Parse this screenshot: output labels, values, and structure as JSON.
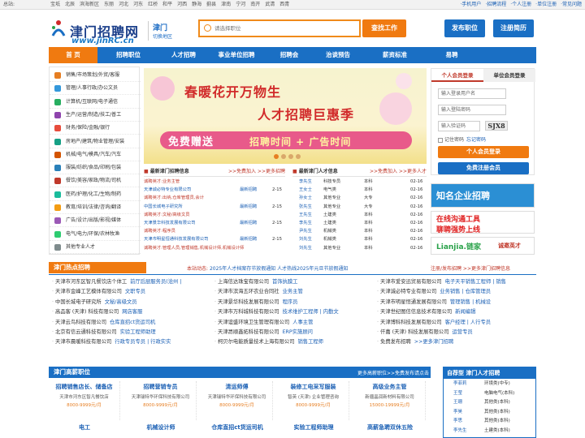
{
  "topbar": {
    "label": "总站:",
    "sites": [
      "宝坻",
      "北辰",
      "滨海新区",
      "东丽",
      "河北",
      "河东",
      "红桥",
      "和平",
      "河西",
      "静海",
      "蓟县",
      "津南",
      "宁河",
      "南开",
      "武清",
      "西青"
    ],
    "links": [
      "·手机用户",
      "·招聘流程",
      "·个人注册",
      "·单位注册",
      "·常见问题"
    ]
  },
  "header": {
    "logo_cn": "津门招聘网",
    "logo_en": "www.jinRC.cn",
    "city": "津门",
    "city_switch": "切换地区",
    "search_placeholder": "请选择职位",
    "search_btn": "查找工作",
    "post_job_btn": "发布职位",
    "register_resume_btn": "注册简历"
  },
  "nav": [
    "首 页",
    "招聘职位",
    "人才招聘",
    "事业单位招聘",
    "招聘会",
    "治谈预告",
    "薪资标准",
    "易聘"
  ],
  "sidebar": [
    "销售/市场策划/外贸/客服",
    "管理/人事行政/办公文员",
    "计算机/互联网/电子通信",
    "生产/运营/制造/技工/普工",
    "财务/保险/金融/银行",
    "房地产/建筑/物业管理/安装",
    "机械/电气/模具/汽车/汽车",
    "服装/纺织/食品/印刷/包装",
    "餐饮/美容/家政/物流/司机",
    "医药/护理/化工/生物/制药",
    "教育/培训/法律/咨询/翻译",
    "广告/设计/出版/影视/媒体",
    "电气/电力/环保/农林牧渔",
    "其他专业人才"
  ],
  "banner": {
    "line1": "春暖花开万物生",
    "line2": "人才招聘巨惠季",
    "line3": "免费赠送",
    "line4": "招聘时间 + 广告时间"
  },
  "login": {
    "tab_person": "个人会员登录",
    "tab_company": "单位会员登录",
    "user_placeholder": "输入登录用户名",
    "pwd_placeholder": "输入登陆密码",
    "code_placeholder": "输入验证码",
    "captcha": "SJX8",
    "remember": "记住密码",
    "forgot": "忘记密码",
    "login_btn": "个人会员登录",
    "register_btn": "免费注册会员"
  },
  "latest_jobs": {
    "title": "最新津门招聘信息",
    "more": ">>免费加入 >>更多招聘",
    "rows": [
      {
        "text": "诚聘英才:业务主管",
        "tag": "",
        "date": ""
      },
      {
        "text": "天津诚必特专业有限公司",
        "tag": "最新招聘",
        "date": "2-15"
      },
      {
        "text": "诚聘英才:出纳,仓库管理员,会计",
        "tag": "",
        "date": ""
      },
      {
        "text": "中国长城电子研究所",
        "tag": "最新招聘",
        "date": "2-15"
      },
      {
        "text": "诚聘英才:文秘/高级文员",
        "tag": "",
        "date": ""
      },
      {
        "text": "天津景华科技发展有限公司",
        "tag": "最新招聘",
        "date": "2-15"
      },
      {
        "text": "诚聘英才:程序员",
        "tag": "",
        "date": ""
      },
      {
        "text": "天津市明星恒通科技发展有限公司",
        "tag": "最新招聘",
        "date": "2-15"
      },
      {
        "text": "诚聘英才:管理人员,管理销售,机械设计师,机械设计师",
        "tag": "",
        "date": ""
      }
    ]
  },
  "latest_talent": {
    "title": "最新津门人才信息",
    "more": ">>免费加入 >>更多人才",
    "rows": [
      {
        "name": "李先生",
        "job": "科技专员",
        "edu": "本科",
        "date": "02-16"
      },
      {
        "name": "王女士",
        "job": "电气类",
        "edu": "本科",
        "date": "02-16"
      },
      {
        "name": "孙女士",
        "job": "其他专业",
        "edu": "大专",
        "date": "02-16"
      },
      {
        "name": "张先生",
        "job": "其他专业",
        "edu": "大专",
        "date": "02-16"
      },
      {
        "name": "王先生",
        "job": "土建类",
        "edu": "本科",
        "date": "02-16"
      },
      {
        "name": "李先生",
        "job": "土建类",
        "edu": "本科",
        "date": "02-16"
      },
      {
        "name": "尹先生",
        "job": "机械类",
        "edu": "本科",
        "date": "02-16"
      },
      {
        "name": "刘先生",
        "job": "机械类",
        "edu": "本科",
        "date": "02-16"
      },
      {
        "name": "刘先生",
        "job": "其他专业",
        "edu": "本科",
        "date": "02-16"
      }
    ]
  },
  "ads": {
    "ad1": "知名企业招聘",
    "ad2_l1": "在线沟通工具",
    "ad2_l2": "聊聘强势上线",
    "ad3_brand": "Lianjia.链家",
    "ad3_text": "诚邀英才"
  },
  "hot": {
    "title": "津门热点招聘",
    "notice_lbl": "本站动态:",
    "notice": "2025年人才档案存节放假通知 人才热线2025年元旦节放假通知",
    "more": "注册/发布招聘 >>更多津门招聘信息",
    "col1": [
      {
        "co": "天津市河东区智凡餐饮店个体工",
        "jb": "前厅后厨服务员(沧州 |"
      },
      {
        "co": "天津市金峰工艺模体有限公司",
        "jb": "文职专员"
      },
      {
        "co": "中国长城电子研究所",
        "jb": "文秘/高级文员"
      },
      {
        "co": "高品客 (天津) 科技有限公司",
        "jb": "网店客服"
      },
      {
        "co": "天津云鸟科技有限公司",
        "jb": "仓库直招ct货运司机"
      },
      {
        "co": "北京有信云通科技有限公司",
        "jb": "实验工程师助理"
      },
      {
        "co": "天津市晨暖科技有限公司",
        "jb": "行政专员专员 | 行政实实"
      }
    ],
    "col2": [
      {
        "co": "上海信达珠宝有限公司",
        "jb": "首饰执膜工"
      },
      {
        "co": "天津市滨海五环农业合同社",
        "jb": "业务主管"
      },
      {
        "co": "天津景华科技发展有限公司",
        "jb": "程序员"
      },
      {
        "co": "天津市万科城科技有限公司",
        "jb": "技术维护工程师 | 内勤文"
      },
      {
        "co": "天津谊盛环境卫生管理有限公司",
        "jb": "人事主管"
      },
      {
        "co": "天津昂顺鑫拓科技有限公司",
        "jb": "ERP实施顾问"
      },
      {
        "co": "柯贝尔电能质量技术上海有限公司",
        "jb": "销售工程师"
      }
    ],
    "col3": [
      {
        "co": "天津市爱安迅贸易有限公司",
        "jb": "电子天平销售工程师 | 销售"
      },
      {
        "co": "天津诚必特专业有限公司",
        "jb": "业务销售 | 仓库管理员"
      },
      {
        "co": "天津市明星恒通发展有限公司",
        "jb": "管理销售 | 机械设"
      },
      {
        "co": "天津世纪图信信息技术有限公司",
        "jb": "新闻编辑"
      },
      {
        "co": "天津博科科技发展有限公司",
        "jb": "客户经理 | 人行专员"
      },
      {
        "co": "仟嘉 (天津) 科技发展有限公司",
        "jb": "运营专员"
      },
      {
        "co": "免费发布招聘",
        "jb": ">>更多津门招聘"
      }
    ]
  },
  "highpay": {
    "title": "津门高薪职位",
    "more": "更多高薪职位>>免费发布请点击",
    "cards": [
      {
        "t": "招聘销售店长、储备店",
        "c": "天津市河东区智凡餐饮店",
        "s": "8000-9999元/月"
      },
      {
        "t": "招聘营销专员",
        "c": "天津瑞特华环保科技有限公司",
        "s": "8000-9999元/月"
      },
      {
        "t": "清运师傅",
        "c": "天津瑞特华环保科技有限公司",
        "s": "8000-9999元/月"
      },
      {
        "t": "装修工电采写服装",
        "c": "智英 (天津) 企业管理咨询",
        "s": "8000-9999元/月"
      },
      {
        "t": "高级业务主管",
        "c": "新疆晶润新材料有限公司",
        "s": "15000-19999元/月"
      }
    ],
    "cards2": [
      "电工",
      "机械设计师",
      "仓库直招ct货运司机",
      "实验工程师助理",
      "高薪急聘双休五险"
    ]
  },
  "recommend": {
    "title": "自荐型 津门人才招聘",
    "rows": [
      {
        "name": "李菲莉",
        "job": "环境类(中专)"
      },
      {
        "name": "王莹",
        "job": "电脑电气(本科)"
      },
      {
        "name": "王珊",
        "job": "其他类(本科)"
      },
      {
        "name": "李昊",
        "job": "其他类(本科)"
      },
      {
        "name": "李思",
        "job": "其他类(本科)"
      },
      {
        "name": "李先生",
        "job": "土建类(本科)"
      }
    ]
  },
  "colors": {
    "blue": "#1a6fc4",
    "orange": "#f07a10",
    "red": "#c0392b"
  }
}
